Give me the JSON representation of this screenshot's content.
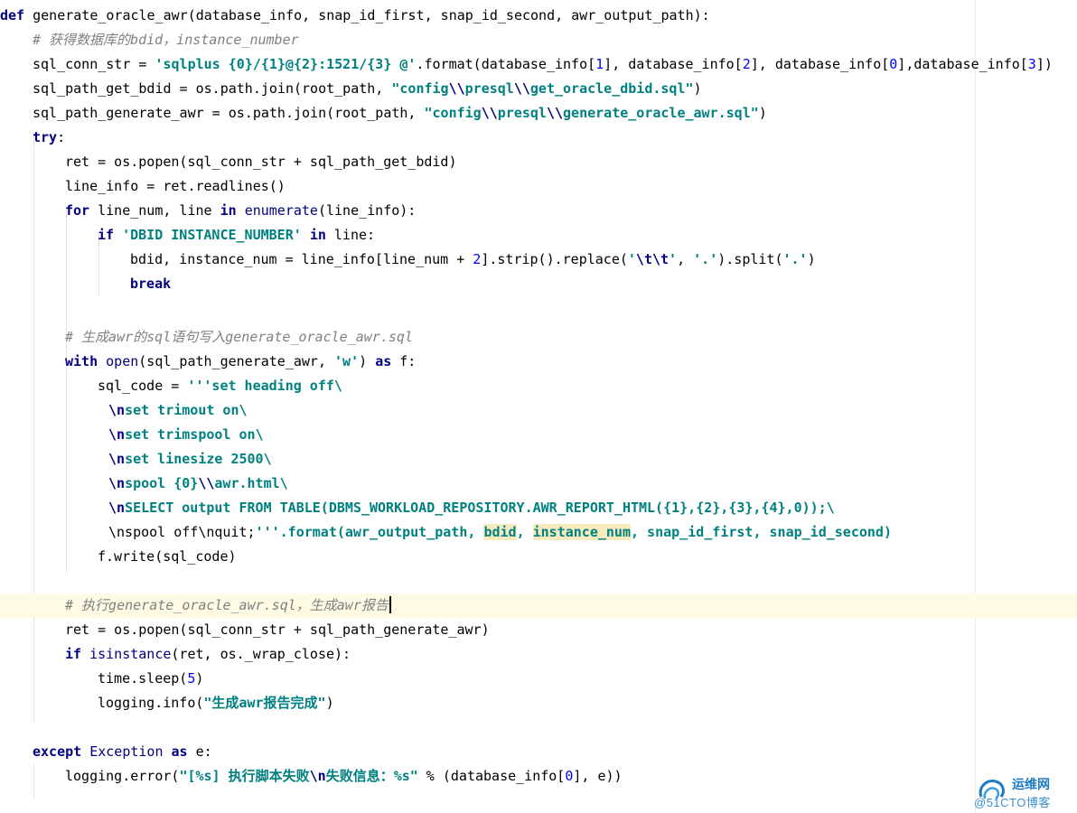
{
  "code_lines": [
    "def generate_oracle_awr(database_info, snap_id_first, snap_id_second, awr_output_path):",
    "# 获得数据库的bdid，instance_number",
    "sql_conn_str = 'sqlplus {0}/{1}@{2}:1521/{3} @'.format(database_info[1], database_info[2], database_info[0],database_info[3])",
    "sql_path_get_bdid = os.path.join(root_path, \"config\\\\presql\\\\get_oracle_dbid.sql\")",
    "sql_path_generate_awr = os.path.join(root_path, \"config\\\\presql\\\\generate_oracle_awr.sql\")",
    "try:",
    "ret = os.popen(sql_conn_str + sql_path_get_bdid)",
    "line_info = ret.readlines()",
    "for line_num, line in enumerate(line_info):",
    "if 'DBID INSTANCE_NUMBER' in line:",
    "bdid, instance_num = line_info[line_num + 2].strip().replace('\\t\\t', '.').split('.')",
    "break",
    "",
    "# 生成awr的sql语句写入generate_oracle_awr.sql",
    "with open(sql_path_generate_awr, 'w') as f:",
    "sql_code = '''set heading off\\",
    "\\nset trimout on\\",
    "\\nset trimspool on\\",
    "\\nset linesize 2500\\",
    "\\nspool {0}\\\\awr.html\\",
    "\\nSELECT output FROM TABLE(DBMS_WORKLOAD_REPOSITORY.AWR_REPORT_HTML({1},{2},{3},{4},0));\\",
    "\\nspool off\\nquit;'''.format(awr_output_path, bdid, instance_num, snap_id_first, snap_id_second)",
    "f.write(sql_code)",
    "",
    "# 执行generate_oracle_awr.sql，生成awr报告",
    "ret = os.popen(sql_conn_str + sql_path_generate_awr)",
    "if isinstance(ret, os._wrap_close):",
    "time.sleep(5)",
    "logging.info(\"生成awr报告完成\")",
    "",
    "except Exception as e:",
    "logging.error(\"[%s] 执行脚本失败\\n失败信息：%s\" % (database_info[0], e))"
  ],
  "watermark": {
    "name": "运维网",
    "site": "@51CTO博客",
    "logo_icon": "cloud-swirl-icon",
    "accent": "#1d7ac2"
  },
  "colors": {
    "keyword": "#000080",
    "string": "#008080",
    "number": "#0000ff",
    "comment": "#808080",
    "current_line": "#fffae3",
    "highlight": "#f6ebbc"
  }
}
